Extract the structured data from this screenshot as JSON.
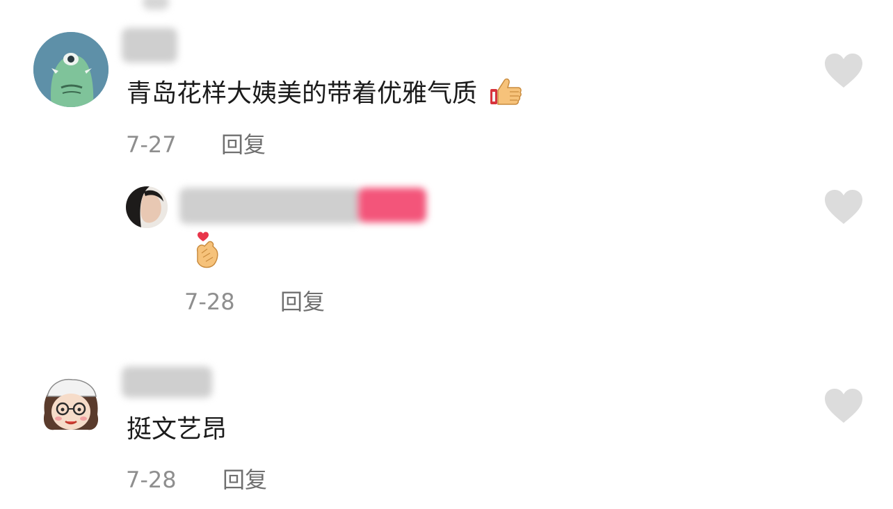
{
  "comments": [
    {
      "text": "青岛花样大姨美的带着优雅气质",
      "emoji_icon": "thumbs-up-icon",
      "date": "7-27",
      "reply_label": "回复",
      "avatar_icon": "green-monster-avatar",
      "like_icon": "heart-icon",
      "replies": [
        {
          "emoji_icon": "finger-heart-icon",
          "date": "7-28",
          "reply_label": "回复",
          "avatar_icon": "user-photo-avatar",
          "like_icon": "heart-icon"
        }
      ]
    },
    {
      "text": "挺文艺昂",
      "date": "7-28",
      "reply_label": "回复",
      "avatar_icon": "cartoon-girl-avatar",
      "like_icon": "heart-icon"
    }
  ],
  "colors": {
    "text": "#1b1b1b",
    "meta": "#8e8e8e",
    "heart": "#dcdcdc",
    "blur_pink": "#f3557a"
  }
}
